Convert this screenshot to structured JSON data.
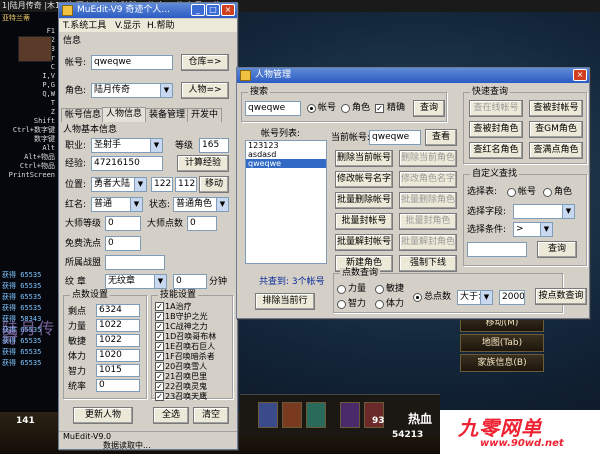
{
  "game": {
    "topbar_text": "1|陆月传奇          |木10倍|哥布林13倍|骷髅15倍|鱼20倍|兔子30倍",
    "left_top": [
      "亚特兰蒂"
    ],
    "left_keys": [
      "F1",
      "F2",
      "F3",
      "Enter",
      "C",
      "I,V",
      "P,G",
      "Q,W",
      "T",
      "Z",
      "Shift",
      "Ctrl+数字键",
      "数字键",
      "Alt",
      "Alt+物品",
      "Ctrl+物品",
      "PrintScreen"
    ],
    "log_lines": [
      "获得 65535",
      "获得 65535",
      "获得 65535",
      "获得 65535",
      "获得 58343",
      "获得 65535",
      "获得 65535",
      "获得 65535",
      "获得 65535"
    ],
    "watermark": "陆月传奇",
    "hp_value": "141",
    "mp_value": "54213",
    "side_num": "93",
    "buttons": [
      "移动(M)",
      "地图(Tab)",
      "家族信息(B)"
    ],
    "brand_left": "热血",
    "brand_main": "九零网单",
    "brand_url": "www.90wd.net"
  },
  "muedit": {
    "title": "MuEdit-V9  奇迹个人...",
    "menu": [
      "T.系统工具",
      "V.显示",
      "H.帮助"
    ],
    "info_group": "信息",
    "account_label": "帐号:",
    "account_value": "qweqwe",
    "warehouse_btn": "仓库=>",
    "role_label": "角色:",
    "role_value": "陆月传奇",
    "person_btn": "人物=>",
    "tabs": [
      "帐号信息",
      "人物信息",
      "装备管理",
      "开发中"
    ],
    "basic_group": "人物基本信息",
    "job_label": "职业:",
    "job_value": "圣射手",
    "level_label": "等级",
    "level_value": "165",
    "exp_label": "经验:",
    "exp_value": "47216150",
    "calc_exp_btn": "计算经验",
    "pos_label": "位置:",
    "pos_value": "勇者大陆",
    "pos_x": "122",
    "pos_y": "112",
    "move_btn": "移动",
    "redname_label": "红名:",
    "redname_value": "普通",
    "state_label": "状态:",
    "state_value": "普通角色",
    "master_level_label": "大师等级",
    "master_level_value": "0",
    "master_points_label": "大师点数",
    "master_points_value": "0",
    "free_wash_label": "免费洗点",
    "free_wash_value": "0",
    "guild_label": "所属战盟",
    "guild_value": "",
    "crest_label": "纹  章",
    "crest_value": "无纹章",
    "minutes_value": "0",
    "minutes_label": "分钟",
    "points_group": "点数设置",
    "stats": [
      {
        "label": "剩点",
        "value": "6324"
      },
      {
        "label": "力量",
        "value": "1022"
      },
      {
        "label": "敏捷",
        "value": "1022"
      },
      {
        "label": "体力",
        "value": "1020"
      },
      {
        "label": "智力",
        "value": "1015"
      },
      {
        "label": "统率",
        "value": "0"
      }
    ],
    "skills_group": "技能设置",
    "skills": [
      "1A治疗",
      "1B守护之光",
      "1C战神之力",
      "1D召唤哥布林",
      "1E召唤石巨人",
      "1F召唤暗杀者",
      "20召唤雪人",
      "21召唤巴里",
      "22召唤灵鬼",
      "23召唤天鹰"
    ],
    "update_btn": "更新人物",
    "select_all_btn": "全选",
    "clear_btn": "清空",
    "status_line1": "MuEdit-V9.0",
    "status_line2": "数据读取中..."
  },
  "person": {
    "title": "人物管理",
    "search_group": "搜索",
    "search_value": "qweqwe",
    "radio_account": "帐号",
    "radio_role": "角色",
    "precise_label": "精确",
    "query_btn": "查询",
    "account_list_label": "帐号列表:",
    "accounts": [
      "123123",
      "asdasd",
      "qweqwe"
    ],
    "current_account_label": "当前帐号:",
    "current_account_value": "qweqwe",
    "view_btn": "查看",
    "action_buttons": [
      {
        "label": "删除当前帐号",
        "enabled": true
      },
      {
        "label": "删除当前角色",
        "enabled": false
      },
      {
        "label": "修改帐号名字",
        "enabled": true
      },
      {
        "label": "修改角色名字",
        "enabled": false
      },
      {
        "label": "批量删除帐号",
        "enabled": true
      },
      {
        "label": "批量删除角色",
        "enabled": false
      },
      {
        "label": "批量封帐号",
        "enabled": true
      },
      {
        "label": "批量封角色",
        "enabled": false
      },
      {
        "label": "批量解封帐号",
        "enabled": true
      },
      {
        "label": "批量解封角色",
        "enabled": false
      },
      {
        "label": "新建角色",
        "enabled": true
      },
      {
        "label": "强制下线",
        "enabled": true
      }
    ],
    "total_text": "共查到: 3个帐号",
    "sort_btn": "排除当前行",
    "points_group": "点数查询",
    "pt_strength": "力量",
    "pt_agility": "敏捷",
    "pt_total": "总点数",
    "pt_op": "大于>",
    "pt_value": "2000",
    "pt_query_btn": "按点数查询",
    "pt_intel": "智力",
    "pt_vit": "体力",
    "quick_group": "快速查询",
    "quick_buttons": [
      {
        "label": "查在线帐号",
        "enabled": false
      },
      {
        "label": "查被封帐号",
        "enabled": true
      },
      {
        "label": "查被封角色",
        "enabled": true
      },
      {
        "label": "查GM角色",
        "enabled": true
      },
      {
        "label": "查红名角色",
        "enabled": true
      },
      {
        "label": "查满点角色",
        "enabled": true
      }
    ],
    "custom_group": "自定义查找",
    "select_table_label": "选择表:",
    "select_table_account": "帐号",
    "select_table_role": "角色",
    "select_field_label": "选择字段:",
    "select_cond_label": "选择条件:",
    "cond_value": ">",
    "custom_query_btn": "查询"
  }
}
